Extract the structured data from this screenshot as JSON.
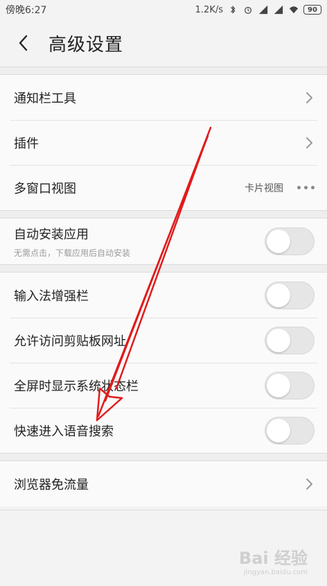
{
  "status_bar": {
    "time": "傍晚6:27",
    "speed": "1.2K/s",
    "battery": "90"
  },
  "header": {
    "title": "高级设置"
  },
  "groups": {
    "g1": [
      {
        "label": "通知栏工具"
      },
      {
        "label": "插件"
      },
      {
        "label": "多窗口视图",
        "value": "卡片视图"
      }
    ],
    "g2": [
      {
        "label": "自动安装应用",
        "sublabel": "无需点击，下载应用后自动安装",
        "on": false
      }
    ],
    "g3": [
      {
        "label": "输入法增强栏",
        "on": false
      },
      {
        "label": "允许访问剪贴板网址",
        "on": false
      },
      {
        "label": "全屏时显示系统状态栏",
        "on": false
      },
      {
        "label": "快速进入语音搜索",
        "on": false
      }
    ],
    "g4": [
      {
        "label": "浏览器免流量"
      }
    ]
  },
  "watermark": {
    "text": "Bai 经验",
    "sub": "jingyan.baidu.com"
  },
  "colors": {
    "annotation_arrow": "#e01b1b",
    "toggle_off": "#e6e6e6"
  }
}
